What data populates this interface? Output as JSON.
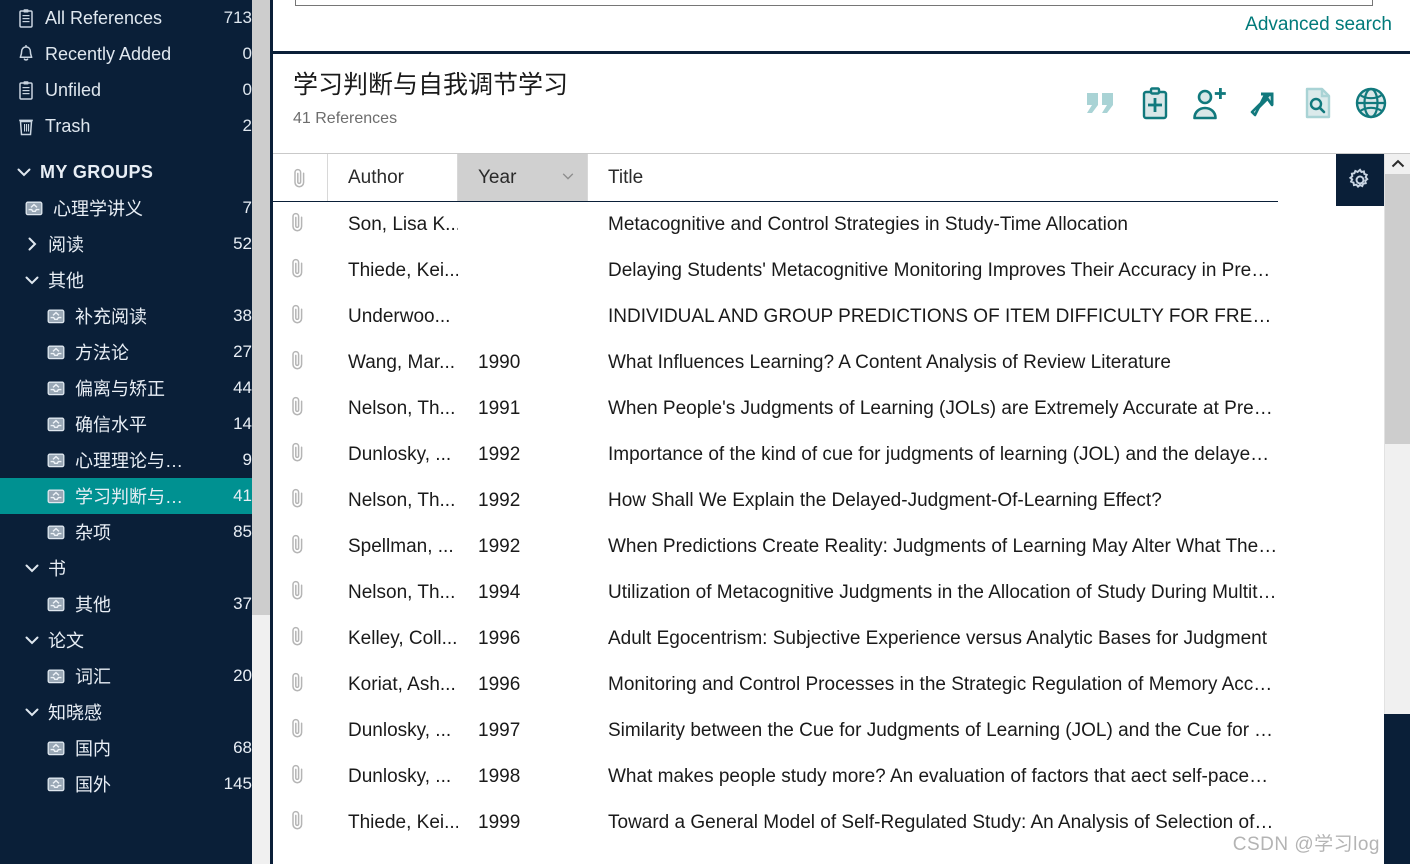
{
  "sidebar": {
    "top_items": [
      {
        "label": "All References",
        "count": "713",
        "icon": "clipboard-icon"
      },
      {
        "label": "Recently Added",
        "count": "0",
        "icon": "bell-icon"
      },
      {
        "label": "Unfiled",
        "count": "0",
        "icon": "clipboard-icon"
      },
      {
        "label": "Trash",
        "count": "2",
        "icon": "trash-icon"
      }
    ],
    "section_label": "MY GROUPS",
    "tree": [
      {
        "type": "leaf",
        "level": 1,
        "label": "心理学讲义",
        "count": "7",
        "icon": "group-icon",
        "selected": false
      },
      {
        "type": "group",
        "level": 1,
        "label": "阅读",
        "count": "52",
        "expanded": false
      },
      {
        "type": "group",
        "level": 1,
        "label": "其他",
        "count": "",
        "expanded": true
      },
      {
        "type": "leaf",
        "level": 2,
        "label": "补充阅读",
        "count": "38",
        "icon": "group-icon",
        "selected": false
      },
      {
        "type": "leaf",
        "level": 2,
        "label": "方法论",
        "count": "27",
        "icon": "group-icon",
        "selected": false
      },
      {
        "type": "leaf",
        "level": 2,
        "label": "偏离与矫正",
        "count": "44",
        "icon": "group-icon",
        "selected": false
      },
      {
        "type": "leaf",
        "level": 2,
        "label": "确信水平",
        "count": "14",
        "icon": "group-icon",
        "selected": false
      },
      {
        "type": "leaf",
        "level": 2,
        "label": "心理理论与…",
        "count": "9",
        "icon": "group-icon",
        "selected": false
      },
      {
        "type": "leaf",
        "level": 2,
        "label": "学习判断与…",
        "count": "41",
        "icon": "group-icon",
        "selected": true
      },
      {
        "type": "leaf",
        "level": 2,
        "label": "杂项",
        "count": "85",
        "icon": "group-icon",
        "selected": false
      },
      {
        "type": "group",
        "level": 1,
        "label": "书",
        "count": "",
        "expanded": true
      },
      {
        "type": "leaf",
        "level": 2,
        "label": "其他",
        "count": "37",
        "icon": "group-icon",
        "selected": false
      },
      {
        "type": "group",
        "level": 1,
        "label": "论文",
        "count": "",
        "expanded": true
      },
      {
        "type": "leaf",
        "level": 2,
        "label": "词汇",
        "count": "20",
        "icon": "group-icon",
        "selected": false
      },
      {
        "type": "group",
        "level": 1,
        "label": "知晓感",
        "count": "",
        "expanded": true
      },
      {
        "type": "leaf",
        "level": 2,
        "label": "国内",
        "count": "68",
        "icon": "group-icon",
        "selected": false
      },
      {
        "type": "leaf",
        "level": 2,
        "label": "国外",
        "count": "145",
        "icon": "group-icon",
        "selected": false
      }
    ]
  },
  "search": {
    "value": "",
    "advanced_label": "Advanced search"
  },
  "header": {
    "title": "学习判断与自我调节学习",
    "subtitle": "41 References",
    "toolbar": [
      {
        "name": "cite-quotes-icon",
        "title": "Insert citation"
      },
      {
        "name": "clipboard-plus-icon",
        "title": "New reference"
      },
      {
        "name": "user-plus-icon",
        "title": "Share group"
      },
      {
        "name": "export-arrow-icon",
        "title": "Export"
      },
      {
        "name": "find-full-text-icon",
        "title": "Find full text"
      },
      {
        "name": "globe-icon",
        "title": "Online search"
      }
    ],
    "gear_name": "settings-gear-icon"
  },
  "table": {
    "columns": [
      {
        "key": "clip",
        "label": "",
        "sorted": false
      },
      {
        "key": "author",
        "label": "Author",
        "sorted": false
      },
      {
        "key": "year",
        "label": "Year",
        "sorted": true
      },
      {
        "key": "title",
        "label": "Title",
        "sorted": false
      }
    ],
    "rows": [
      {
        "author": "Son, Lisa K...",
        "year": "",
        "title": "Metacognitive and Control Strategies in Study-Time Allocation"
      },
      {
        "author": "Thiede, Kei...",
        "year": "",
        "title": "Delaying Students' Metacognitive Monitoring Improves Their Accuracy in Predictin…"
      },
      {
        "author": "Underwoo...",
        "year": "",
        "title": "INDIVIDUAL AND GROUP PREDICTIONS OF ITEM DIFFICULTY FOR FREE LEARNINGx"
      },
      {
        "author": "Wang, Mar...",
        "year": "1990",
        "title": "What Influences Learning? A Content Analysis of Review Literature"
      },
      {
        "author": "Nelson, Th...",
        "year": "1991",
        "title": "When People's Judgments of Learning (JOLs) are Extremely Accurate at Predicting S…"
      },
      {
        "author": "Dunlosky, ...",
        "year": "1992",
        "title": "Importance of the kind of cue for judgments of learning (JOL) and the delayed-JOL…"
      },
      {
        "author": "Nelson, Th...",
        "year": "1992",
        "title": "How Shall We Explain the Delayed-Judgment-Of-Learning Effect?"
      },
      {
        "author": "Spellman, ...",
        "year": "1992",
        "title": "When Predictions Create Reality: Judgments of Learning May Alter What They Are I…"
      },
      {
        "author": "Nelson, Th...",
        "year": "1994",
        "title": "Utilization of Metacognitive Judgments in the Allocation of Study During Multitrial …"
      },
      {
        "author": "Kelley, Coll...",
        "year": "1996",
        "title": "Adult Egocentrism: Subjective Experience versus Analytic Bases for Judgment"
      },
      {
        "author": "Koriat, Ash...",
        "year": "1996",
        "title": "Monitoring and Control Processes in the Strategic Regulation of Memory Accuracy"
      },
      {
        "author": "Dunlosky, ...",
        "year": "1997",
        "title": "Similarity between the Cue for Judgments of Learning (JOL) and the Cue for Test Is …"
      },
      {
        "author": "Dunlosky, ...",
        "year": "1998",
        "title": "What makes people study more? An evaluation of factors that aect self-paced study"
      },
      {
        "author": "Thiede, Kei...",
        "year": "1999",
        "title": "Toward a General Model of Self-Regulated Study: An Analysis of Selection of Items …"
      }
    ]
  },
  "watermark": "CSDN @学习log",
  "colors": {
    "sidebar_bg": "#0a1f38",
    "accent_teal": "#009191",
    "link_teal": "#007a7a",
    "icon_teal": "#11797d",
    "sorted_col_bg": "#d0d0d0"
  }
}
